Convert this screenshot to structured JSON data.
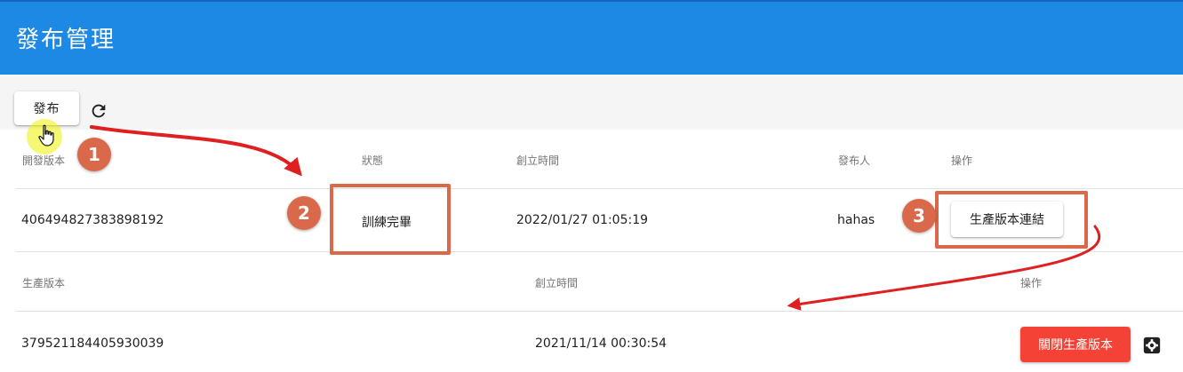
{
  "app": {
    "title": "發布管理"
  },
  "toolbar": {
    "publish_label": "發布"
  },
  "dev_table": {
    "headers": {
      "version": "開發版本",
      "status": "狀態",
      "created": "創立時間",
      "publisher": "發布人",
      "actions": "操作"
    },
    "row": {
      "version": "406494827383898192",
      "status": "訓練完畢",
      "created": "2022/01/27 01:05:19",
      "publisher": "hahas",
      "action_label": "生產版本連結"
    }
  },
  "prod_table": {
    "headers": {
      "version": "生產版本",
      "created": "創立時間",
      "actions": "操作"
    },
    "row": {
      "version": "379521184405930039",
      "created": "2021/11/14 00:30:54",
      "close_label": "關閉生產版本"
    }
  },
  "annotations": {
    "steps": [
      "1",
      "2",
      "3"
    ],
    "color": "#d9694a",
    "arrow_color": "#e02020"
  },
  "icons": [
    "refresh-icon",
    "hand-pointer-icon",
    "settings-icon"
  ]
}
